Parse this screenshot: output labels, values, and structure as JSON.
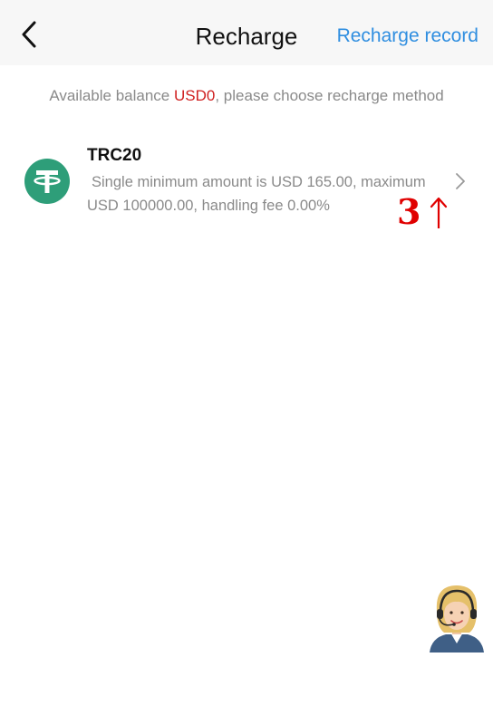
{
  "header": {
    "title": "Recharge",
    "record_link": "Recharge record",
    "back_icon": "chevron-left-icon"
  },
  "balance": {
    "prefix": "Available balance ",
    "value": "USD0",
    "suffix": ", please choose recharge method"
  },
  "methods": [
    {
      "name": "TRC20",
      "description": "Single minimum amount is USD 165.00, maximum USD 100000.00, handling fee 0.00%",
      "icon": "tether-icon",
      "icon_color": "#2e9e79"
    }
  ],
  "annotation": {
    "label": "3",
    "arrow": "up-arrow-icon",
    "color": "#e00000"
  },
  "support": {
    "icon": "customer-service-avatar"
  },
  "colors": {
    "accent": "#2f8ee0",
    "balance_value": "#cf2020",
    "muted_text": "#8a8a8a",
    "header_bg": "#f7f7f7"
  }
}
